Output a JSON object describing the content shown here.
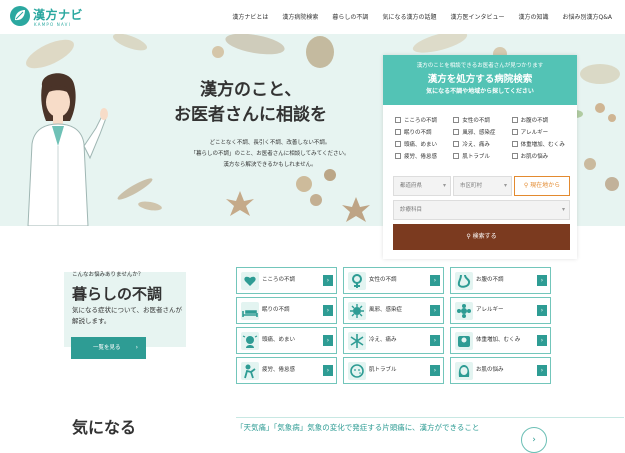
{
  "logo": {
    "title": "漢方ナビ",
    "subtitle": "KAMPO NAVI"
  },
  "nav": [
    "漢方ナビとは",
    "漢方病院検索",
    "暮らしの不調",
    "気になる漢方の話題",
    "漢方医インタビュー",
    "漢方の知識",
    "お悩み別漢方Q&A"
  ],
  "hero": {
    "title_line1": "漢方のこと、",
    "title_line2": "お医者さんに相談を",
    "desc": [
      "どことなく不調、長引く不調、改善しない不調。",
      "「暮らしの不調」のこと、お医者さんに相談してみてください。",
      "漢方なら解決できるかもしれません。"
    ]
  },
  "search": {
    "lead": "漢方のことを相談できるお医者さんが見つかります",
    "title": "漢方を処方する病院検索",
    "sub": "気になる不調や地域から探してください",
    "checks": [
      "こころの不調",
      "女性の不調",
      "お腹の不調",
      "眠りの不調",
      "風邪、感染症",
      "アレルギー",
      "頭痛、めまい",
      "冷え、痛み",
      "体重増加、むくみ",
      "疲労、倦怠感",
      "肌トラブル",
      "お肌の悩み"
    ],
    "pref_placeholder": "都道府県",
    "city_placeholder": "市区町村",
    "location_button": "現在地から",
    "dept_placeholder": "診療科目",
    "search_button": "検索する"
  },
  "trouble": {
    "lead": "こんなお悩みありませんか？",
    "title": "暮らしの不調",
    "desc": "気になる症状について、お医者さんが解説します。",
    "list_button": "一覧を見る"
  },
  "categories": [
    "こころの不調",
    "女性の不調",
    "お腹の不調",
    "眠りの不調",
    "風邪、感染症",
    "アレルギー",
    "頭痛、めまい",
    "冷え、痛み",
    "体重増加、むくみ",
    "疲労、倦怠感",
    "肌トラブル",
    "お肌の悩み"
  ],
  "section2": {
    "title": "気になる",
    "headline": "「天気痛」「気象病」気象の変化で発症する片頭痛に、漢方ができること"
  },
  "colors": {
    "teal": "#53c3b5",
    "dark_teal": "#2e9c94",
    "brown": "#7b3a1f",
    "orange": "#e38a2f",
    "hero_bg": "#e7f4f1"
  }
}
